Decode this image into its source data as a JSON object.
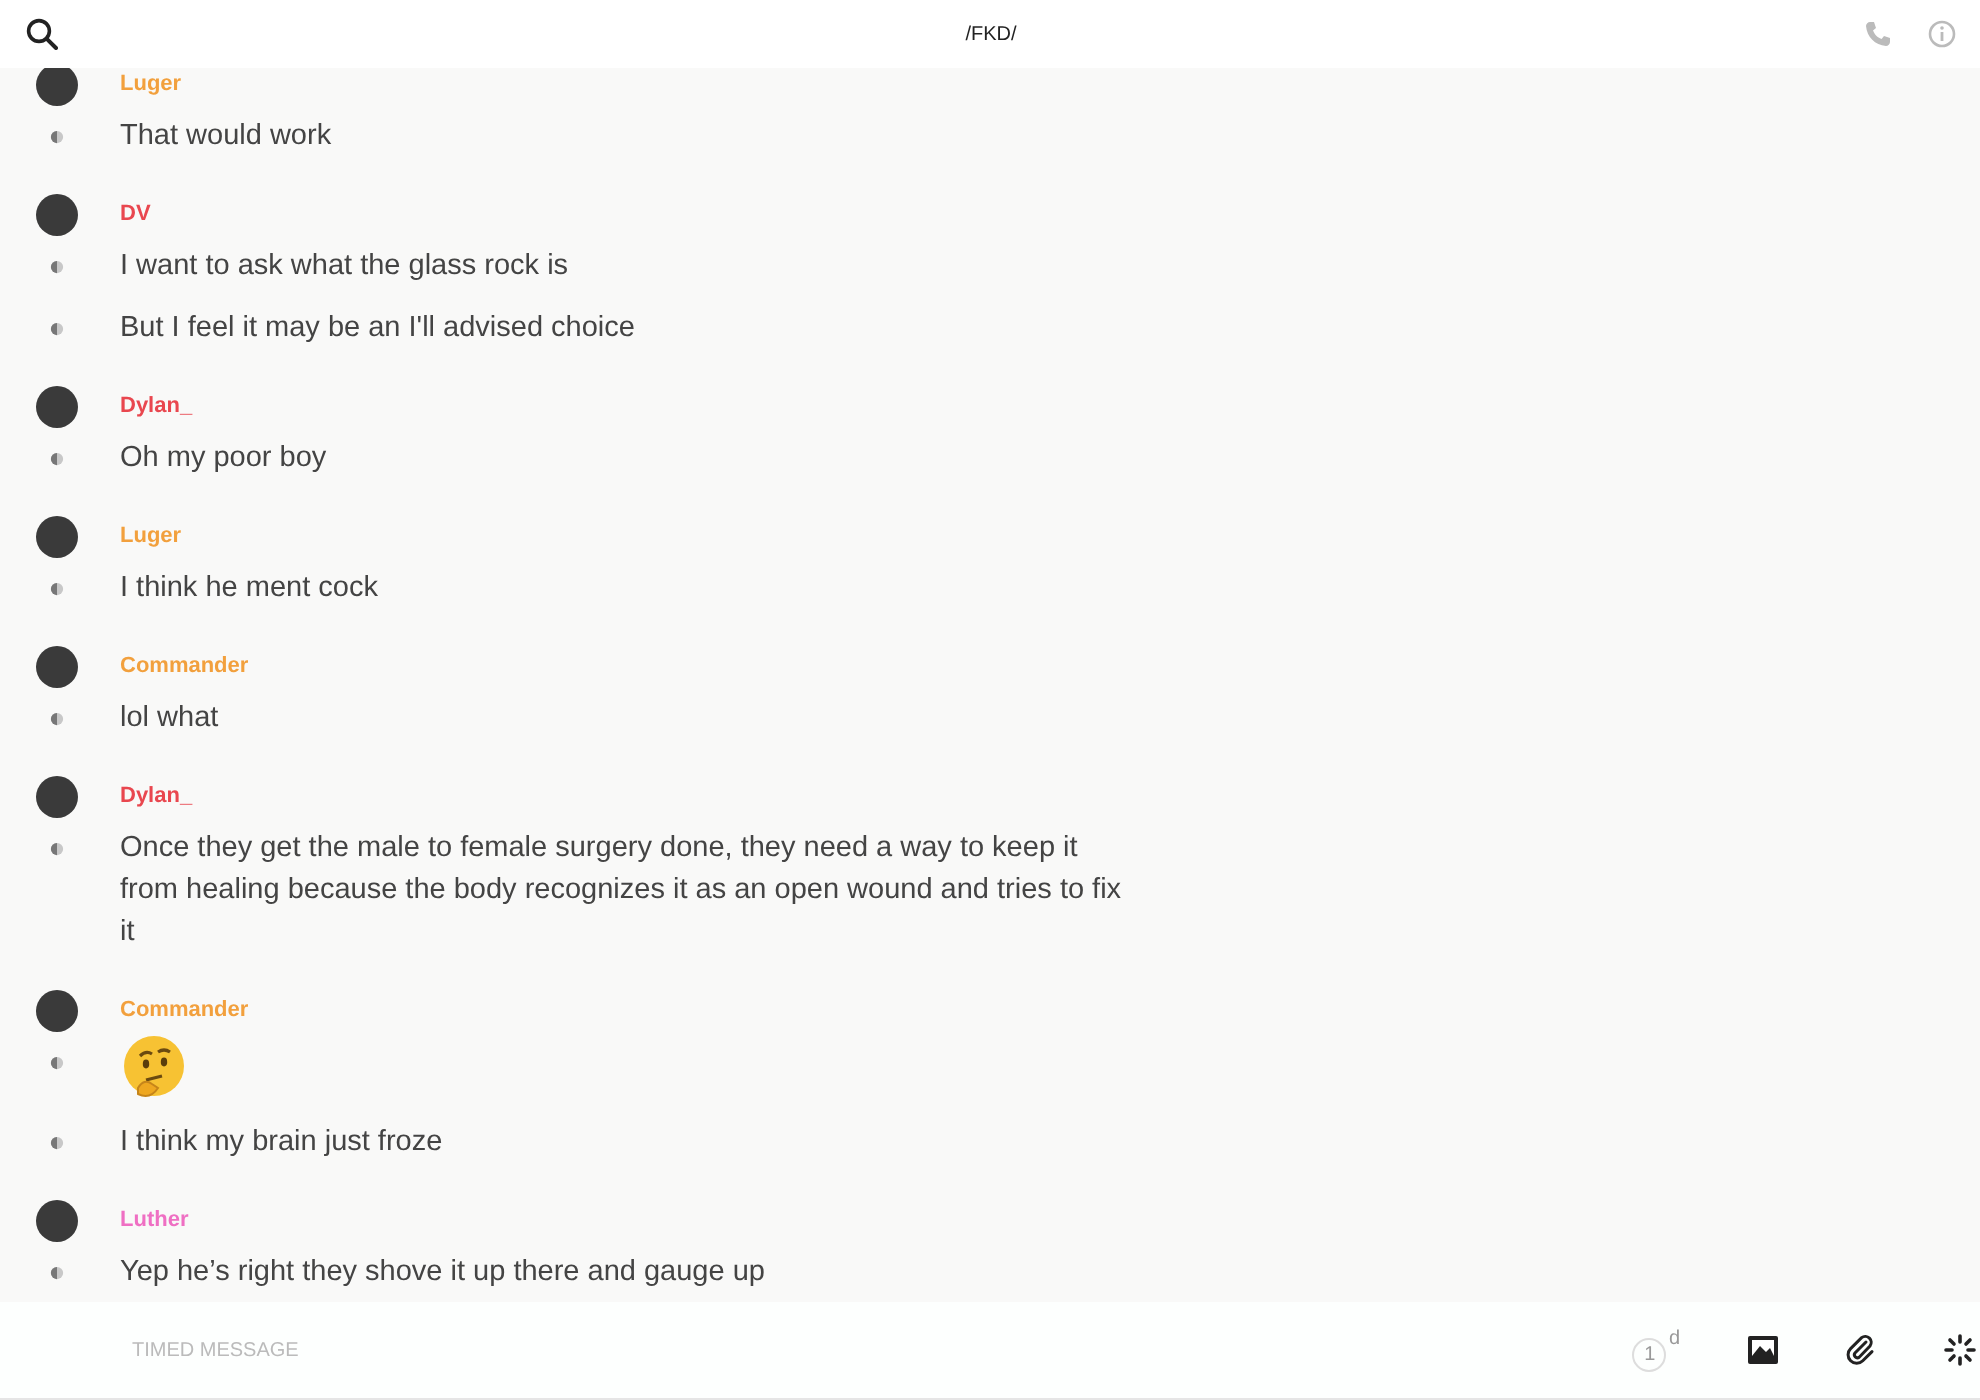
{
  "header": {
    "title": "/FKD/"
  },
  "messages": [
    {
      "author": "Luger",
      "color": "#f2a03d",
      "lines": [
        {
          "kind": "text",
          "text": "That would work"
        }
      ]
    },
    {
      "author": "DV",
      "color": "#e9474f",
      "lines": [
        {
          "kind": "text",
          "text": "I want to ask what the glass rock is"
        },
        {
          "kind": "text",
          "text": "But I feel it may be an I'll advised choice"
        }
      ]
    },
    {
      "author": "Dylan_",
      "color": "#e9474f",
      "lines": [
        {
          "kind": "text",
          "text": "Oh my poor boy"
        }
      ]
    },
    {
      "author": "Luger",
      "color": "#f2a03d",
      "lines": [
        {
          "kind": "text",
          "text": "I think he ment cock"
        }
      ]
    },
    {
      "author": "Commander",
      "color": "#f2a03d",
      "lines": [
        {
          "kind": "text",
          "text": "lol what"
        }
      ]
    },
    {
      "author": "Dylan_",
      "color": "#e9474f",
      "lines": [
        {
          "kind": "text",
          "text": "Once they get the male to female surgery done, they need a way to keep it from healing because the body recognizes it as an open wound and tries to fix it"
        }
      ]
    },
    {
      "author": "Commander",
      "color": "#f2a03d",
      "lines": [
        {
          "kind": "emoji"
        },
        {
          "kind": "text",
          "text": "I think my brain just froze"
        }
      ]
    },
    {
      "author": "Luther",
      "color": "#ef6fc3",
      "lines": [
        {
          "kind": "text",
          "text": "Yep he’s right they shove it up there and gauge up"
        }
      ]
    }
  ],
  "composer": {
    "placeholder": "TIMED MESSAGE",
    "timer": "1",
    "timer_unit": "d"
  }
}
